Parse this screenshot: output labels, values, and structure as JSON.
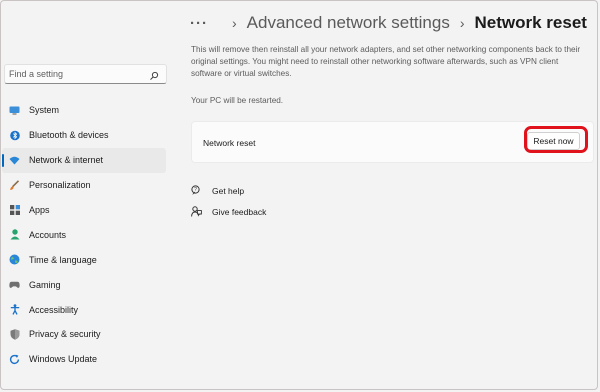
{
  "breadcrumb": {
    "overflow": "···",
    "separator": "›",
    "parent": "Advanced network settings",
    "current": "Network reset"
  },
  "search": {
    "placeholder": "Find a setting",
    "value": ""
  },
  "sidebar": {
    "items": [
      {
        "label": "System",
        "icon": "system-icon",
        "active": false
      },
      {
        "label": "Bluetooth & devices",
        "icon": "bluetooth-icon",
        "active": false
      },
      {
        "label": "Network & internet",
        "icon": "wifi-icon",
        "active": true
      },
      {
        "label": "Personalization",
        "icon": "brush-icon",
        "active": false
      },
      {
        "label": "Apps",
        "icon": "apps-icon",
        "active": false
      },
      {
        "label": "Accounts",
        "icon": "accounts-icon",
        "active": false
      },
      {
        "label": "Time & language",
        "icon": "globe-icon",
        "active": false
      },
      {
        "label": "Gaming",
        "icon": "gaming-icon",
        "active": false
      },
      {
        "label": "Accessibility",
        "icon": "accessibility-icon",
        "active": false
      },
      {
        "label": "Privacy & security",
        "icon": "shield-icon",
        "active": false
      },
      {
        "label": "Windows Update",
        "icon": "update-icon",
        "active": false
      }
    ]
  },
  "main": {
    "description": "This will remove then reinstall all your network adapters, and set other networking components back to their original settings. You might need to reinstall other networking software afterwards, such as VPN client software or virtual switches.",
    "restart_note": "Your PC will be restarted.",
    "card": {
      "label": "Network reset",
      "button_label": "Reset now"
    },
    "links": [
      {
        "label": "Get help",
        "icon": "help-icon"
      },
      {
        "label": "Give feedback",
        "icon": "feedback-icon"
      }
    ]
  },
  "colors": {
    "accent": "#0067c0",
    "highlight": "#e0121c",
    "background": "#f3f3f3"
  }
}
